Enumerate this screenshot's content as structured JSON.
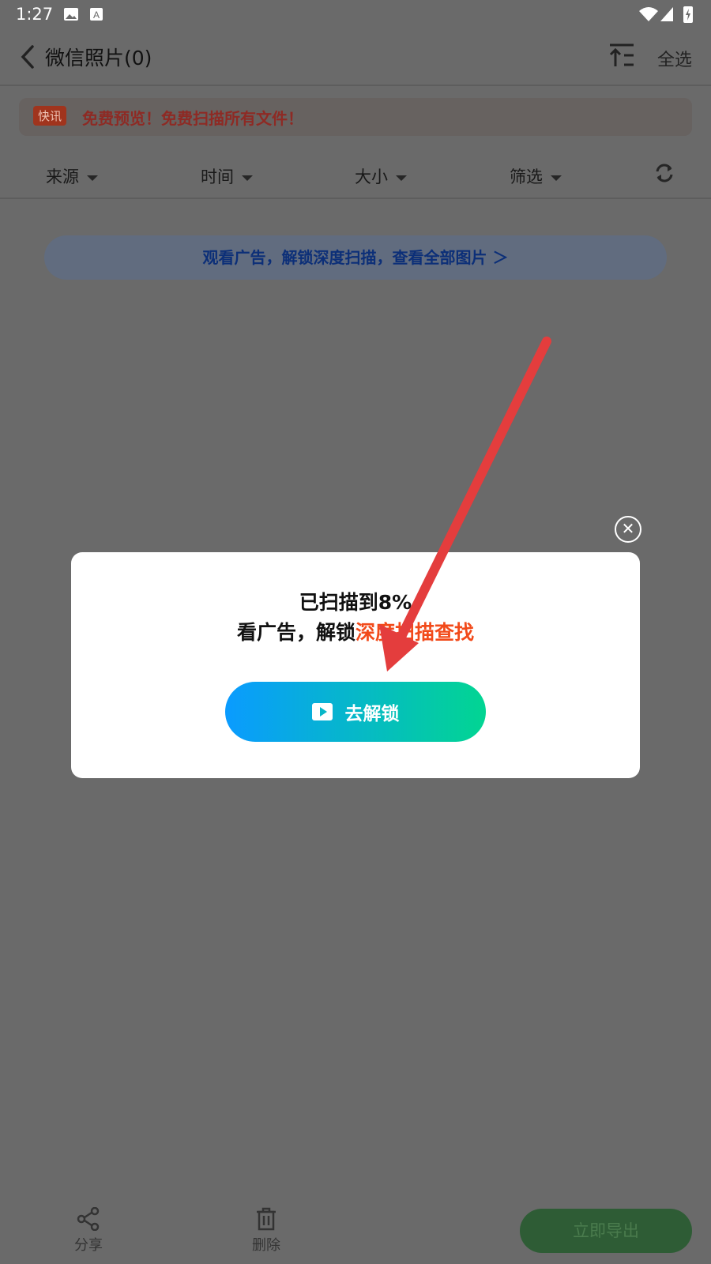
{
  "status_bar": {
    "time": "1:27"
  },
  "app_bar": {
    "title": "微信照片(0)",
    "select_all": "全选"
  },
  "notice": {
    "tag": "快讯",
    "text": "免费预览！免费扫描所有文件！"
  },
  "filters": [
    {
      "label": "来源"
    },
    {
      "label": "时间"
    },
    {
      "label": "大小"
    },
    {
      "label": "筛选"
    }
  ],
  "ad_banner": {
    "text": "观看广告，解锁深度扫描，查看全部图片 ＞"
  },
  "dialog": {
    "line1": "已扫描到8%",
    "line2_prefix": "看广告，解锁",
    "line2_highlight": "深度扫描查找",
    "button_label": "去解锁"
  },
  "bottom_bar": {
    "share": "分享",
    "delete": "删除",
    "export": "立即导出"
  },
  "colors": {
    "highlight": "#f24a1a",
    "gradient_start": "#0a9bff",
    "gradient_end": "#02d592",
    "arrow": "#e43d3d"
  },
  "icons": [
    "back-arrow-icon",
    "sort-icon",
    "refresh-icon",
    "share-icon",
    "trash-icon",
    "close-icon",
    "play-icon"
  ]
}
